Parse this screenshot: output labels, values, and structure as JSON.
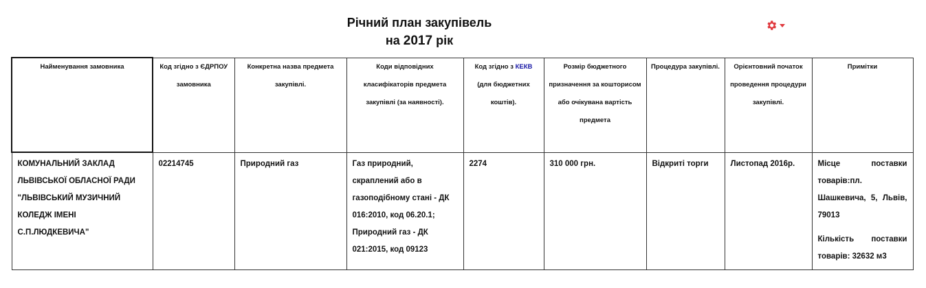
{
  "title": {
    "line1": "Річний план закупівель",
    "line2_prefix": "на ",
    "line2_year": "2017",
    "line2_suffix": " рік"
  },
  "settings_menu": {
    "icon": "gear-icon",
    "caret": "caret-down-icon",
    "color": "#e0393e"
  },
  "table": {
    "headers": {
      "customer": "Найменування замовника",
      "edrpou": "Код згідно з ЄДРПОУ замовника",
      "subject": "Конкретна назва предмета закупівлі.",
      "classifier": "Коди відповідних класифікаторів предмета закупівлі (за наявності).",
      "kekv_prefix": "Код згідно з ",
      "kekv_link": "КЕКВ",
      "kekv_suffix": " (для бюджетних коштів).",
      "budget": "Розмір бюджетного призначення за кошторисом або очікувана вартість предмета",
      "procedure": "Процедура закупівлі.",
      "start": "Орієнтовний початок проведення процедури закупівлі.",
      "notes": "Примітки"
    },
    "row": {
      "customer": "КОМУНАЛЬНИЙ ЗАКЛАД ЛЬВІВСЬКОЇ ОБЛАСНОЇ РАДИ \"ЛЬВІВСЬКИЙ МУЗИЧНИЙ КОЛЕДЖ ІМЕНІ С.П.ЛЮДКЕВИЧА\"",
      "edrpou": "02214745",
      "subject": "Природний газ",
      "classifier_1": "Газ природний, скраплений або в газоподібному стані - ДК 016:2010, код 06.20.1;",
      "classifier_2": "Природний газ - ДК 021:2015, код 09123",
      "kekv": "2274",
      "budget": "310 000 грн.",
      "procedure": "Відкриті торги",
      "start": "Листопад 2016р.",
      "notes_1": "Місце поставки товарів:пл. Шашкевича, 5, Львів, 79013",
      "notes_2": "Кількість поставки товарів: 32632 м3"
    }
  },
  "colors": {
    "link": "#1a1aa6",
    "gear": "#e0393e"
  }
}
